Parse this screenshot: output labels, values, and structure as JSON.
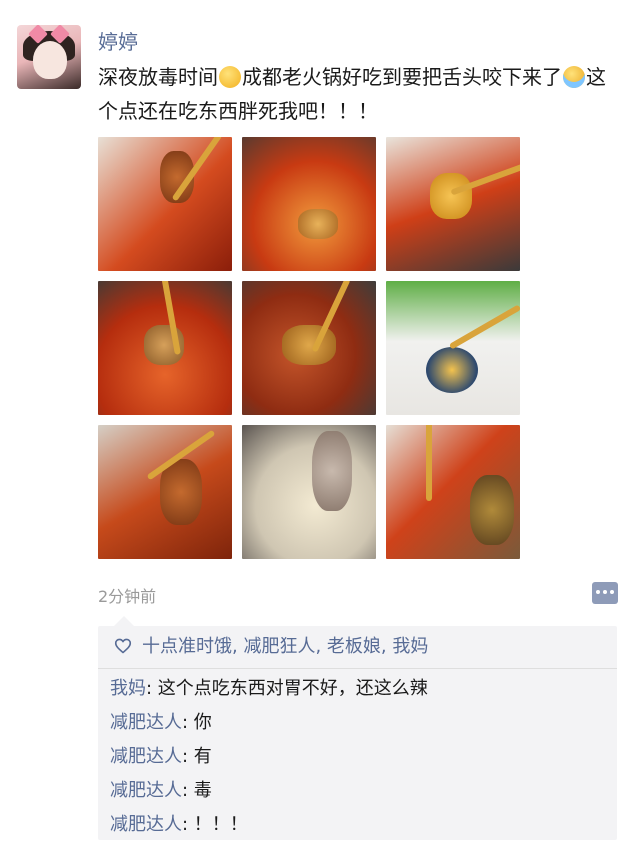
{
  "post": {
    "author": "婷婷",
    "text_part1": "深夜放毒时间",
    "text_part2": "成都老火锅好吃到要把舌头咬下来了",
    "text_part3": "这个点还在吃东西胖死我吧！！！",
    "emoji_1": "smile-emoji",
    "emoji_2": "crying-emoji",
    "photo_count": 9,
    "time": "2分钟前"
  },
  "likes": {
    "icon": "heart-icon",
    "names": "十点准时饿, 减肥狂人, 老板娘, 我妈"
  },
  "comments": [
    {
      "author": "我妈",
      "sep": ": ",
      "text": "这个点吃东西对胃不好，还这么辣"
    },
    {
      "author": "减肥达人",
      "sep": ": ",
      "text": "你"
    },
    {
      "author": "减肥达人",
      "sep": ": ",
      "text": "有"
    },
    {
      "author": "减肥达人",
      "sep": ": ",
      "text": "毒"
    },
    {
      "author": "减肥达人",
      "sep": ": ",
      "text": "！！！"
    }
  ],
  "colors": {
    "link": "#576b95",
    "text": "#1a1a1a",
    "muted": "#9a9a9a",
    "feedback_bg": "#f3f3f5"
  }
}
